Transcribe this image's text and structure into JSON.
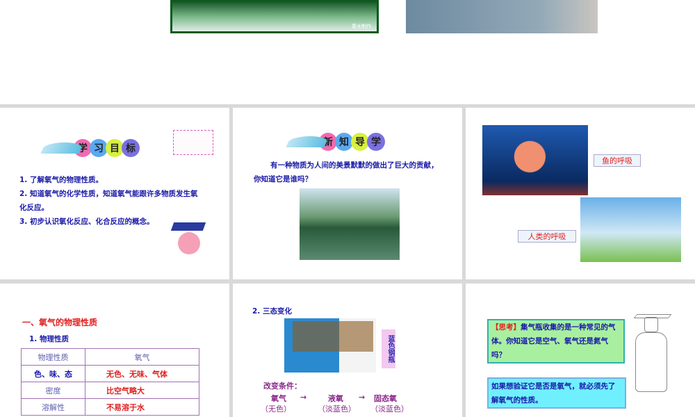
{
  "slide1": {
    "image1_caption": "春水制作"
  },
  "slide2": {
    "badge": [
      "学",
      "习",
      "目",
      "标"
    ],
    "objectives": [
      "1. 了解氧气的物理性质。",
      "2. 知道氧气的化学性质，知道氧气能跟许多物质发生氧",
      "化反应。",
      "3. 初步认识氧化反应、化合反应的概念。"
    ]
  },
  "slide3": {
    "badge": [
      "新",
      "知",
      "导",
      "学"
    ],
    "text1": "有一种物质为人间的美景默默的做出了巨大的贡献，",
    "text2": "你知道它是谁吗？"
  },
  "slide4": {
    "fish_label": "鱼的呼吸",
    "human_label": "人类的呼吸"
  },
  "slide5": {
    "heading": "一、氧气的物理性质",
    "sub": "1. 物理性质",
    "table": {
      "headers": [
        "物理性质",
        "氧气"
      ],
      "rows": [
        [
          "色、味、态",
          "无色、无味、气体"
        ],
        [
          "密度",
          "比空气略大"
        ],
        [
          "溶解性",
          "不易溶于水"
        ]
      ]
    }
  },
  "slide6": {
    "sub": "2. 三态变化",
    "tank_label": "蓝色钢瓶",
    "cond": "改变条件：",
    "states": [
      "氧气",
      "液氧",
      "固态氧"
    ],
    "arrow": "→",
    "colors": [
      "（无色）",
      "（淡蓝色）",
      "（淡蓝色）"
    ]
  },
  "slide7": {
    "think_tag": "【思考】",
    "think_text": "集气瓶收集的是一种常见的气体。你知道它是空气、氧气还是氮气吗？",
    "verify": "如果想验证它是否是氧气，就必须先了解氧气的性质。"
  }
}
